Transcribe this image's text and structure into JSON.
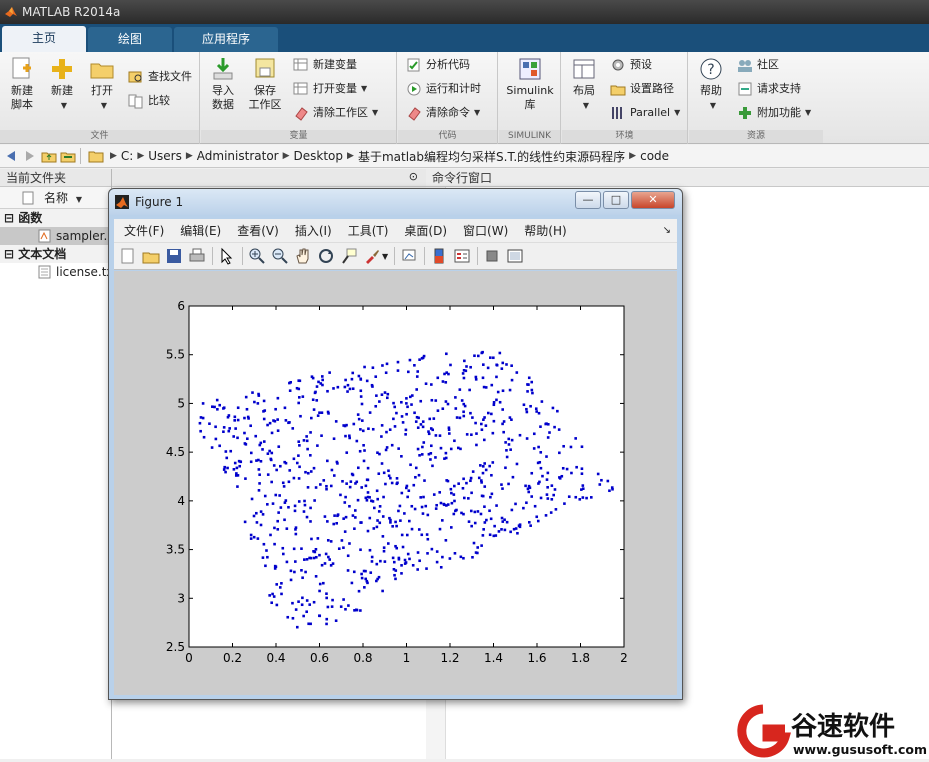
{
  "window": {
    "title": "MATLAB R2014a"
  },
  "tabs": [
    {
      "label": "主页",
      "active": true
    },
    {
      "label": "绘图",
      "active": false
    },
    {
      "label": "应用程序",
      "active": false
    }
  ],
  "ribbon": {
    "file": {
      "label": "文件",
      "new_script": "新建\n脚本",
      "new": "新建",
      "open": "打开",
      "find_files": "查找文件",
      "compare": "比较"
    },
    "variable": {
      "label": "变量",
      "import": "导入\n数据",
      "save_ws": "保存\n工作区",
      "new_var": "新建变量",
      "open_var": "打开变量",
      "clear_ws": "清除工作区"
    },
    "code": {
      "label": "代码",
      "analyze": "分析代码",
      "run_time": "运行和计时",
      "clear_cmd": "清除命令"
    },
    "simulink": {
      "label": "SIMULINK",
      "btn": "Simulink\n库"
    },
    "env": {
      "label": "环境",
      "layout": "布局",
      "prefs": "预设",
      "set_path": "设置路径",
      "parallel": "Parallel"
    },
    "resources": {
      "label": "资源",
      "help": "帮助",
      "community": "社区",
      "request_support": "请求支持",
      "addons": "附加功能"
    }
  },
  "address": {
    "crumbs": [
      "C:",
      "Users",
      "Administrator",
      "Desktop",
      "基于matlab编程均匀采样S.T.的线性约束源码程序",
      "code"
    ]
  },
  "current_folder": {
    "title": "当前文件夹",
    "name_col": "名称",
    "groups": [
      {
        "label": "函数",
        "files": [
          "sampler.m"
        ]
      },
      {
        "label": "文本文档",
        "files": [
          "license.txt"
        ]
      }
    ]
  },
  "command_window": {
    "title": "命令行窗口"
  },
  "figure": {
    "title": "Figure 1",
    "menu": [
      "文件(F)",
      "编辑(E)",
      "查看(V)",
      "插入(I)",
      "工具(T)",
      "桌面(D)",
      "窗口(W)",
      "帮助(H)"
    ]
  },
  "watermark": {
    "brand": "谷速软件",
    "url": "www.gususoft.com"
  },
  "chart_data": {
    "type": "scatter",
    "xlim": [
      0,
      2
    ],
    "ylim": [
      2.5,
      6
    ],
    "xticks": [
      "0",
      "0.2",
      "0.4",
      "0.6",
      "0.8",
      "1",
      "1.2",
      "1.4",
      "1.6",
      "1.8",
      "2"
    ],
    "yticks": [
      "2.5",
      "3",
      "3.5",
      "4",
      "4.5",
      "5",
      "5.5",
      "6"
    ],
    "marker_color": "#0000cc",
    "region_polygon": [
      [
        0.0,
        4.95
      ],
      [
        0.1,
        5.05
      ],
      [
        0.35,
        5.15
      ],
      [
        0.6,
        5.3
      ],
      [
        0.85,
        5.45
      ],
      [
        1.15,
        5.5
      ],
      [
        1.3,
        5.6
      ],
      [
        1.42,
        5.65
      ],
      [
        1.55,
        5.3
      ],
      [
        1.75,
        4.85
      ],
      [
        1.88,
        4.3
      ],
      [
        1.98,
        4.1
      ],
      [
        1.75,
        3.95
      ],
      [
        1.5,
        3.65
      ],
      [
        1.2,
        3.3
      ],
      [
        0.9,
        3.05
      ],
      [
        0.7,
        2.72
      ],
      [
        0.5,
        2.52
      ],
      [
        0.38,
        2.9
      ],
      [
        0.34,
        3.3
      ],
      [
        0.2,
        3.95
      ],
      [
        0.15,
        4.4
      ],
      [
        0.05,
        4.7
      ]
    ],
    "approx_point_count": 900
  }
}
